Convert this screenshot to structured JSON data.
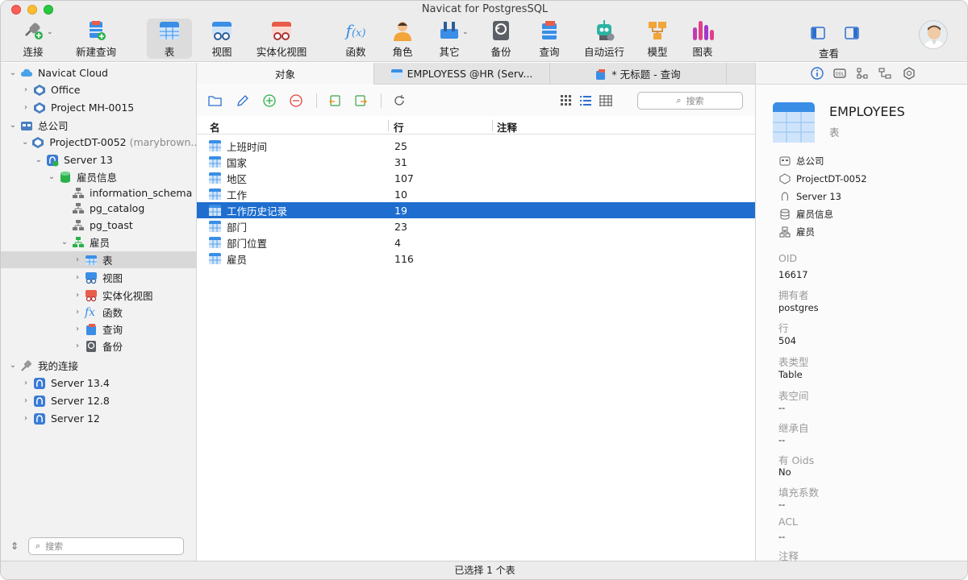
{
  "window": {
    "title": "Navicat for PostgresSQL"
  },
  "toolbar": {
    "items": [
      {
        "label": "连接"
      },
      {
        "label": "新建查询"
      },
      {
        "label": "表"
      },
      {
        "label": "视图"
      },
      {
        "label": "实体化视图"
      },
      {
        "label": "函数"
      },
      {
        "label": "角色"
      },
      {
        "label": "其它"
      },
      {
        "label": "备份"
      },
      {
        "label": "查询"
      },
      {
        "label": "自动运行"
      },
      {
        "label": "模型"
      },
      {
        "label": "图表"
      },
      {
        "label": "查看"
      }
    ]
  },
  "sidebar": {
    "tree": [
      {
        "label": "Navicat Cloud"
      },
      {
        "label": "Office"
      },
      {
        "label": "Project MH-0015"
      },
      {
        "label": "总公司"
      },
      {
        "label": "ProjectDT-0052",
        "sub": "(marybrown..."
      },
      {
        "label": "Server 13"
      },
      {
        "label": "雇员信息"
      },
      {
        "label": "information_schema"
      },
      {
        "label": "pg_catalog"
      },
      {
        "label": "pg_toast"
      },
      {
        "label": "雇员"
      },
      {
        "label": "表"
      },
      {
        "label": "视图"
      },
      {
        "label": "实体化视图"
      },
      {
        "label": "函数"
      },
      {
        "label": "查询"
      },
      {
        "label": "备份"
      },
      {
        "label": "我的连接"
      },
      {
        "label": "Server 13.4"
      },
      {
        "label": "Server 12.8"
      },
      {
        "label": "Server 12"
      }
    ],
    "search_placeholder": "搜索"
  },
  "tabs": [
    {
      "label": "对象"
    },
    {
      "label": "EMPLOYESS @HR (Serv..."
    },
    {
      "label": "* 无标题 - 查询"
    }
  ],
  "objects": {
    "search_placeholder": "搜索",
    "columns": [
      "名",
      "行",
      "注释"
    ],
    "rows": [
      {
        "name": "上班时间",
        "rows": "25"
      },
      {
        "name": "国家",
        "rows": "31"
      },
      {
        "name": "地区",
        "rows": "107"
      },
      {
        "name": "工作",
        "rows": "10"
      },
      {
        "name": "工作历史记录",
        "rows": "19"
      },
      {
        "name": "部门",
        "rows": "23"
      },
      {
        "name": "部门位置",
        "rows": "4"
      },
      {
        "name": "雇员",
        "rows": "116"
      }
    ]
  },
  "info": {
    "name": "EMPLOYEES",
    "type": "表",
    "path": [
      "总公司",
      "ProjectDT-0052",
      "Server 13",
      "雇员信息",
      "雇员"
    ],
    "props": [
      {
        "label": "OID",
        "value": "16617"
      },
      {
        "label": "拥有者",
        "value": "postgres"
      },
      {
        "label": "行",
        "value": "504"
      },
      {
        "label": "表类型",
        "value": "Table"
      },
      {
        "label": "表空间",
        "value": "--"
      },
      {
        "label": "继承自",
        "value": "--"
      },
      {
        "label": "有 Oids",
        "value": "No"
      },
      {
        "label": "填充系数",
        "value": "--"
      },
      {
        "label": "ACL",
        "value": "--"
      },
      {
        "label": "注释",
        "value": ""
      }
    ]
  },
  "status": {
    "text": "已选择 1 个表"
  },
  "colors": {
    "accent": "#1f6ecf",
    "table_icon": "#3a8ee6"
  }
}
